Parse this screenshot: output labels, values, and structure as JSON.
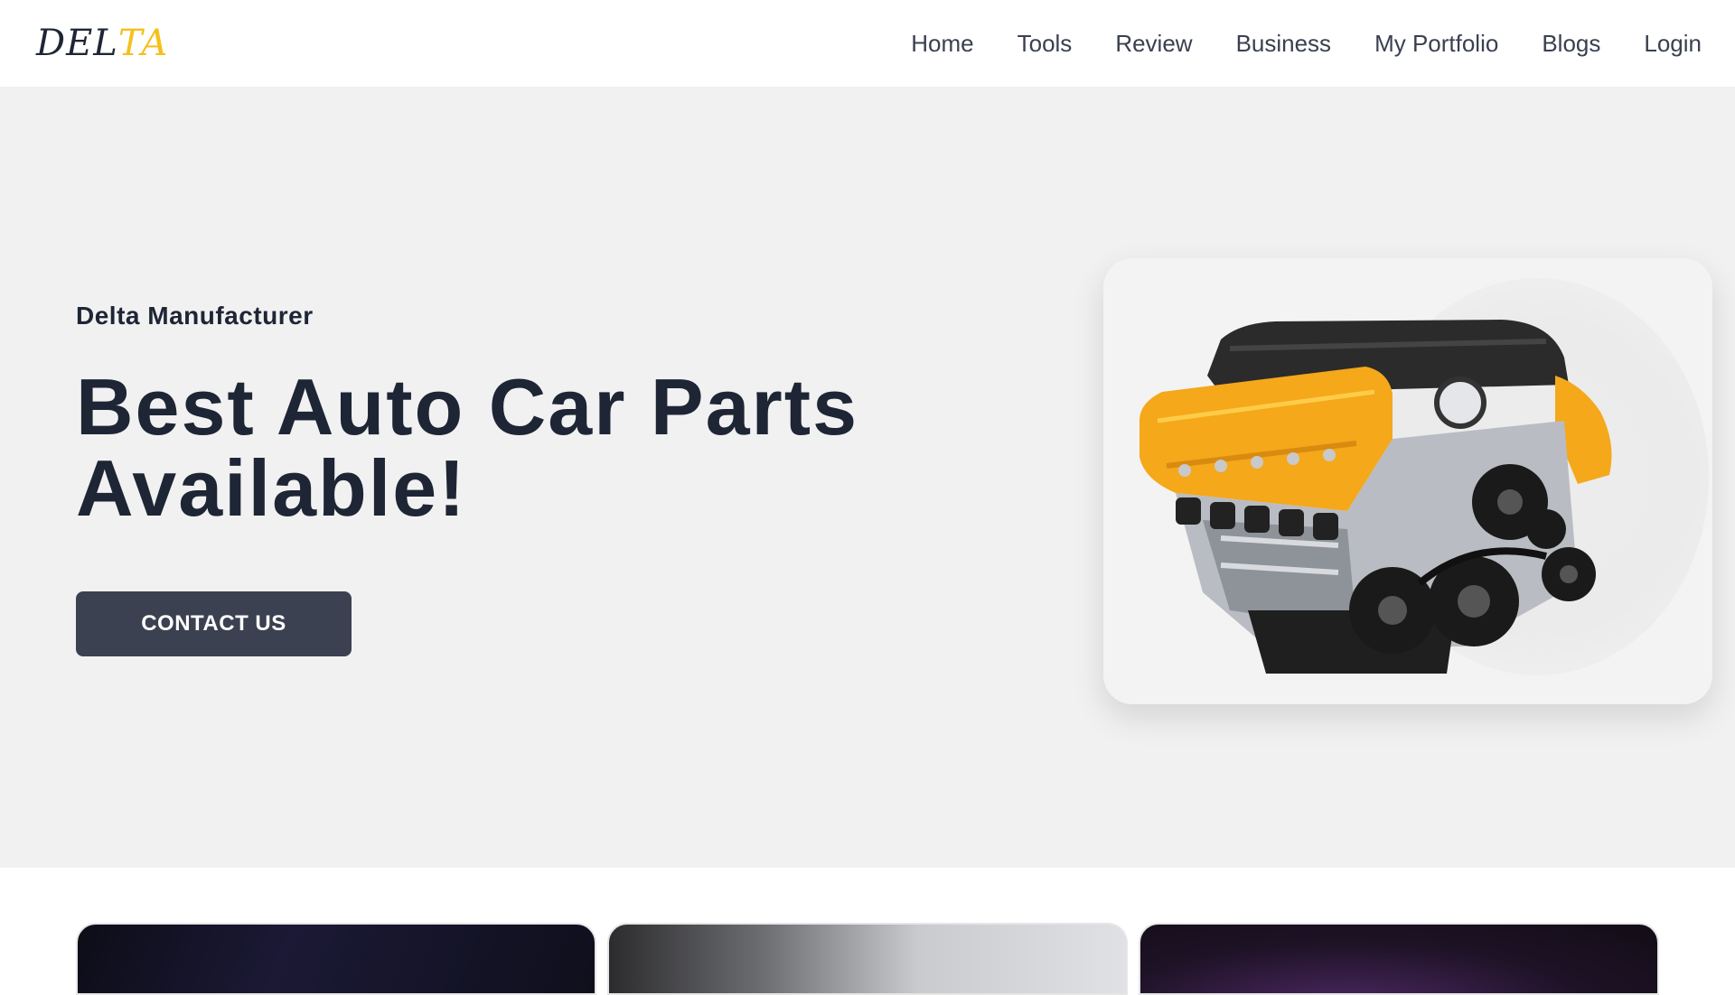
{
  "brand": {
    "logo_main": "DEL",
    "logo_accent": "TA",
    "accent_color": "#f5c01d",
    "text_color": "#1e2535"
  },
  "nav": {
    "items": [
      {
        "label": "Home"
      },
      {
        "label": "Tools"
      },
      {
        "label": "Review"
      },
      {
        "label": "Business"
      },
      {
        "label": "My Portfolio"
      },
      {
        "label": "Blogs"
      },
      {
        "label": "Login"
      }
    ]
  },
  "hero": {
    "eyebrow": "Delta Manufacturer",
    "headline_line1": "Best Auto Car Parts",
    "headline_line2": "Available!",
    "cta_label": "CONTACT US",
    "cta_color": "#3b4150",
    "background_color": "#f1f1f1",
    "image_icon": "car-engine-icon"
  },
  "previews": [
    {
      "icon": "dark-car-interior-image"
    },
    {
      "icon": "car-interior-window-image"
    },
    {
      "icon": "purple-gradient-image"
    }
  ]
}
